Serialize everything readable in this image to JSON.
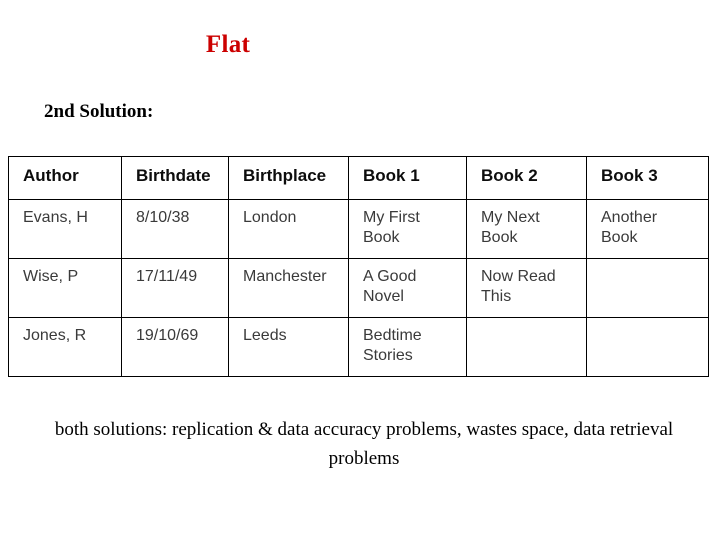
{
  "slide": {
    "title": "Flat",
    "title_color": "#cc0000",
    "sub_heading": "2nd Solution:",
    "caption": "both solutions: replication & data accuracy problems, wastes space, data retrieval problems"
  },
  "table": {
    "columns": [
      "Author",
      "Birthdate",
      "Birthplace",
      "Book 1",
      "Book 2",
      "Book 3"
    ],
    "rows": [
      {
        "author": "Evans, H",
        "birthdate": "8/10/38",
        "birthplace": "London",
        "book1": "My First\nBook",
        "book2": "My Next\nBook",
        "book3": "Another\nBook"
      },
      {
        "author": "Wise, P",
        "birthdate": "17/11/49",
        "birthplace": "Manchester",
        "book1": "A Good\nNovel",
        "book2": "Now Read\nThis",
        "book3": ""
      },
      {
        "author": "Jones, R",
        "birthdate": "19/10/69",
        "birthplace": "Leeds",
        "book1": "Bedtime\nStories",
        "book2": "",
        "book3": ""
      }
    ]
  }
}
